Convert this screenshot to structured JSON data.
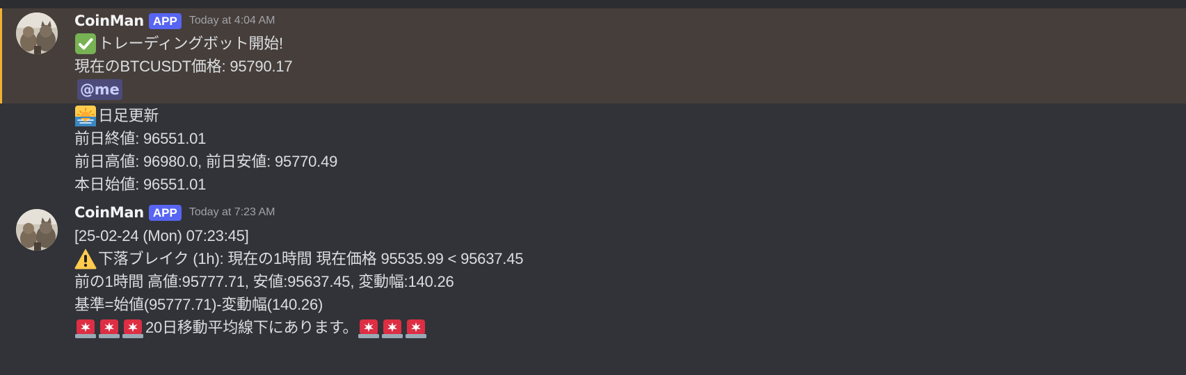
{
  "messages": [
    {
      "username": "CoinMan",
      "badge": "APP",
      "timestamp": "Today at 4:04 AM",
      "mentioned": true,
      "lines": {
        "l1_text": "トレーディングボット開始!",
        "l2_text": "現在のBTCUSDT価格: 95790.17",
        "mention": "@me",
        "l4_text": "日足更新",
        "l5_text": "前日終値: 96551.01",
        "l6_text": "前日高値: 96980.0, 前日安値: 95770.49",
        "l7_text": "本日始値: 96551.01"
      }
    },
    {
      "username": "CoinMan",
      "badge": "APP",
      "timestamp": "Today at 7:23 AM",
      "mentioned": false,
      "lines": {
        "l1_text": "[25-02-24 (Mon) 07:23:45]",
        "l2_text": "下落ブレイク (1h): 現在の1時間 現在価格 95535.99 < 95637.45",
        "l3_text": "前の1時間 高値:95777.71, 安値:95637.45, 変動幅:140.26",
        "l4_text": "基準=始値(95777.71)-変動幅(140.26)",
        "l5_text": "20日移動平均線下にあります。"
      }
    }
  ],
  "colors": {
    "background": "#313338",
    "mention_highlight": "#463e3a",
    "mention_bar": "#f0b232",
    "badge": "#5865f2"
  },
  "icons": {
    "check": "white-check-mark-icon",
    "sunrise": "sunrise-icon",
    "warning": "warning-icon",
    "siren": "rotating-light-icon"
  }
}
